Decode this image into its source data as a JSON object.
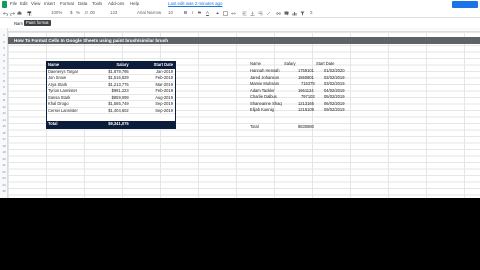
{
  "menu": {
    "items": [
      "File",
      "Edit",
      "View",
      "Insert",
      "Format",
      "Data",
      "Tools",
      "Add-ons",
      "Help"
    ],
    "last_edit": "Last edit was 2 minutes ago"
  },
  "toolbar": {
    "zoom": "100%",
    "currency": "$",
    "percent": "%",
    "decimals": ".0 .00",
    "number_format": "123",
    "font": "Arial Narrow",
    "font_size": "10"
  },
  "namebar": {
    "name_box": "Nam",
    "tooltip": "Paint format"
  },
  "sheet": {
    "title": "How To Format Cells In Google Sheets using paint brush/similar brush",
    "row_numbers": [
      "1",
      "2",
      "3",
      "4",
      "5",
      "6",
      "7",
      "8",
      "9",
      "10",
      "11",
      "12",
      "13",
      "14",
      "15",
      "16",
      "17",
      "18",
      "19",
      "20",
      "21",
      "22",
      "23",
      "24",
      "25"
    ]
  },
  "left_table": {
    "headers": [
      "Name",
      "Salary",
      "Start Date"
    ],
    "rows": [
      [
        "Daenerys Targar",
        "$1,879,795",
        "Jan-2019"
      ],
      [
        "Jon Snow",
        "$1,516,829",
        "Feb-2019"
      ],
      [
        "Arya Stark",
        "$1,213,775",
        "Mar-2019"
      ],
      [
        "Tyrion Lannister",
        "$981,223",
        "Feb-2019"
      ],
      [
        "Sansa Stark",
        "$859,099",
        "Aug-2019"
      ],
      [
        "Khal Drogo",
        "$1,565,749",
        "Sep-2019"
      ],
      [
        "Cersei Lannister",
        "$1,404,602",
        "Sep-2019"
      ]
    ],
    "total_label": "Total",
    "total_value": "$9,341,075"
  },
  "right_table": {
    "headers": [
      "Name",
      "Salary",
      "Start Date"
    ],
    "rows": [
      [
        "Hannah Hensah",
        "1759101",
        "01/02/2020"
      ],
      [
        "Jared Johanson",
        "1550801",
        "02/02/2019"
      ],
      [
        "Mamie Muhsam",
        "715379",
        "03/02/2019"
      ],
      [
        "Adam Tackler",
        "1661124",
        "04/02/2019"
      ],
      [
        "Charlie Dalbus",
        "797103",
        "05/02/2019"
      ],
      [
        "Shaneanne Shaq",
        "1213165",
        "06/02/2019"
      ],
      [
        "Elijah Koenig",
        "1218109",
        "09/02/2019"
      ]
    ],
    "total_label": "Total",
    "total_value": "8830880"
  },
  "colors": {
    "header_navy": "#0b1d3a",
    "title_gray": "#5f6368",
    "link_blue": "#1a73e8"
  }
}
